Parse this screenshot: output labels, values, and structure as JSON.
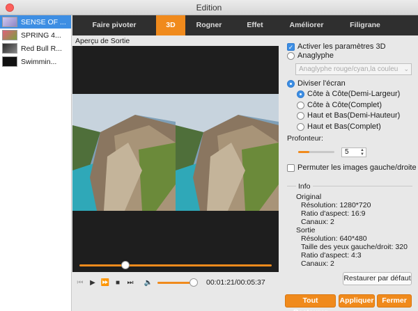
{
  "window": {
    "title": "Edition"
  },
  "files": [
    {
      "name": "SENSE OF ...",
      "selected": true,
      "thumb_color": "#b5b0d8"
    },
    {
      "name": "SPRING 4...",
      "selected": false,
      "thumb_color": "#c04a6a"
    },
    {
      "name": "Red Bull R...",
      "selected": false,
      "thumb_color": "#555555"
    },
    {
      "name": "Swimmin...",
      "selected": false,
      "thumb_color": "#111111"
    }
  ],
  "tabs": [
    {
      "label": "Faire pivoter",
      "active": false
    },
    {
      "label": "3D",
      "active": true
    },
    {
      "label": "Rogner",
      "active": false
    },
    {
      "label": "Effet",
      "active": false
    },
    {
      "label": "Améliorer",
      "active": false
    },
    {
      "label": "Filigrane",
      "active": false
    }
  ],
  "preview": {
    "label": "Aperçu de Sortie",
    "seek_fraction": 0.24,
    "volume_fraction": 1.0,
    "timecode": "00:01:21/00:05:37"
  },
  "settings": {
    "enable_3d": "Activer les paramètres 3D",
    "anaglyph": "Anaglyphe",
    "anaglyph_select": "Anaglyphe rouge/cyan,la couleu",
    "split_screen": "Diviser l'écran",
    "options": [
      "Côte à Côte(Demi-Largeur)",
      "Côte à Côte(Complet)",
      "Haut et Bas(Demi-Hauteur)",
      "Haut et Bas(Complet)"
    ],
    "depth_label": "Profonteur:",
    "depth_value": "5",
    "depth_fraction": 0.3,
    "swap_lr": "Permuter les images gauche/droite"
  },
  "info": {
    "title": "Info",
    "original_label": "Original",
    "original_resolution": "Résolution: 1280*720",
    "original_ratio": "Ratio d'aspect: 16:9",
    "original_channels": "Canaux: 2",
    "output_label": "Sortie",
    "output_resolution": "Résolution: 640*480",
    "output_eye": "Taille des yeux gauche/droit: 320",
    "output_ratio": "Ratio d'aspect: 4:3",
    "output_channels": "Canaux: 2"
  },
  "buttons": {
    "restore_default": "Restaurer par défaut",
    "restore_all": "Tout Restaurer",
    "apply": "Appliquer",
    "close": "Fermer"
  },
  "colors": {
    "accent": "#f08a1c",
    "selection": "#3d8ee3",
    "tabbar": "#2f2f2f"
  }
}
